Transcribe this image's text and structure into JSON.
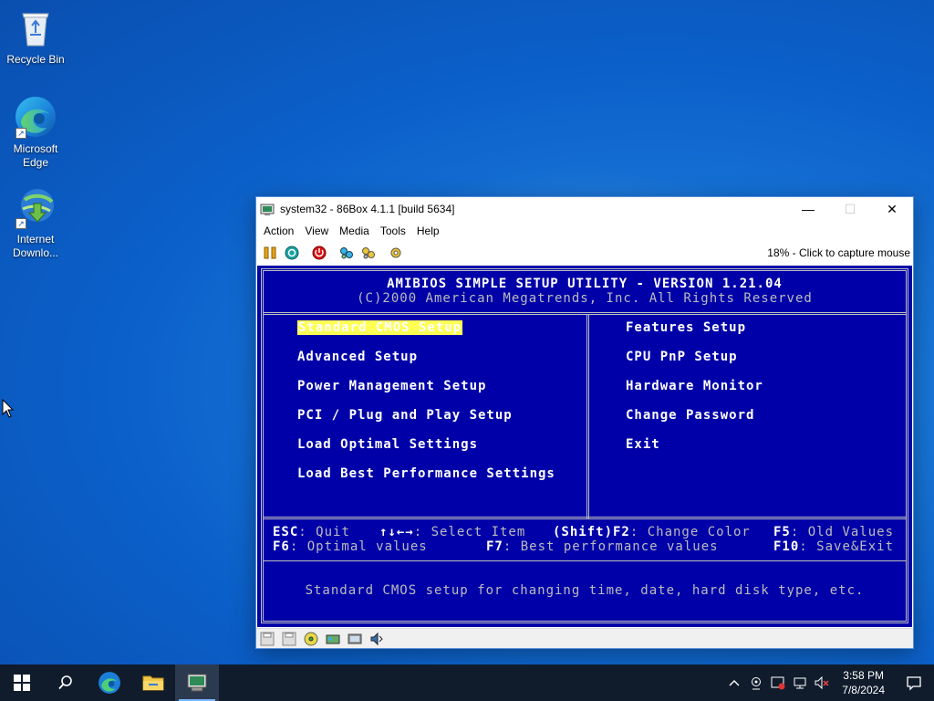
{
  "desktop": {
    "icons": [
      {
        "label": "Recycle Bin",
        "icon": "recycle-bin-icon"
      },
      {
        "label": "Microsoft Edge",
        "icon": "edge-icon"
      },
      {
        "label": "Internet Downlo...",
        "icon": "internet-download-manager-icon"
      }
    ]
  },
  "window": {
    "title": "system32 - 86Box 4.1.1 [build 5634]",
    "menu": [
      "Action",
      "View",
      "Media",
      "Tools",
      "Help"
    ],
    "capture_hint": "18% - Click to capture mouse",
    "controls": {
      "minimize": "—",
      "maximize": "☐",
      "close": "✕"
    }
  },
  "bios": {
    "header_title": "AMIBIOS SIMPLE SETUP UTILITY - VERSION 1.21.04",
    "header_copyright": "(C)2000 American Megatrends, Inc. All Rights Reserved",
    "left_menu": [
      "Standard CMOS Setup",
      "Advanced Setup",
      "Power Management Setup",
      "PCI / Plug and Play Setup",
      "Load Optimal Settings",
      "Load Best Performance Settings"
    ],
    "right_menu": [
      "Features Setup",
      "CPU PnP Setup",
      "Hardware Monitor",
      "Change Password",
      "Exit"
    ],
    "selected": "Standard CMOS Setup",
    "help_row1": [
      {
        "key": "ESC",
        "desc": ": Quit"
      },
      {
        "key": "↑↓←→",
        "desc": ": Select Item"
      },
      {
        "key": "(Shift)F2",
        "desc": ": Change Color"
      },
      {
        "key": "F5",
        "desc": ": Old Values"
      }
    ],
    "help_row2": [
      {
        "key": "F6",
        "desc": ": Optimal values"
      },
      {
        "key": "F7",
        "desc": ": Best performance values"
      },
      {
        "key": "F10",
        "desc": ": Save&Exit"
      }
    ],
    "description": "Standard CMOS setup for changing time, date, hard disk type, etc."
  },
  "taskbar": {
    "time": "3:58 PM",
    "date": "7/8/2024"
  },
  "colors": {
    "bios_bg": "#0000a8",
    "highlight": "#ffff54",
    "taskbar": "#101c2c"
  }
}
